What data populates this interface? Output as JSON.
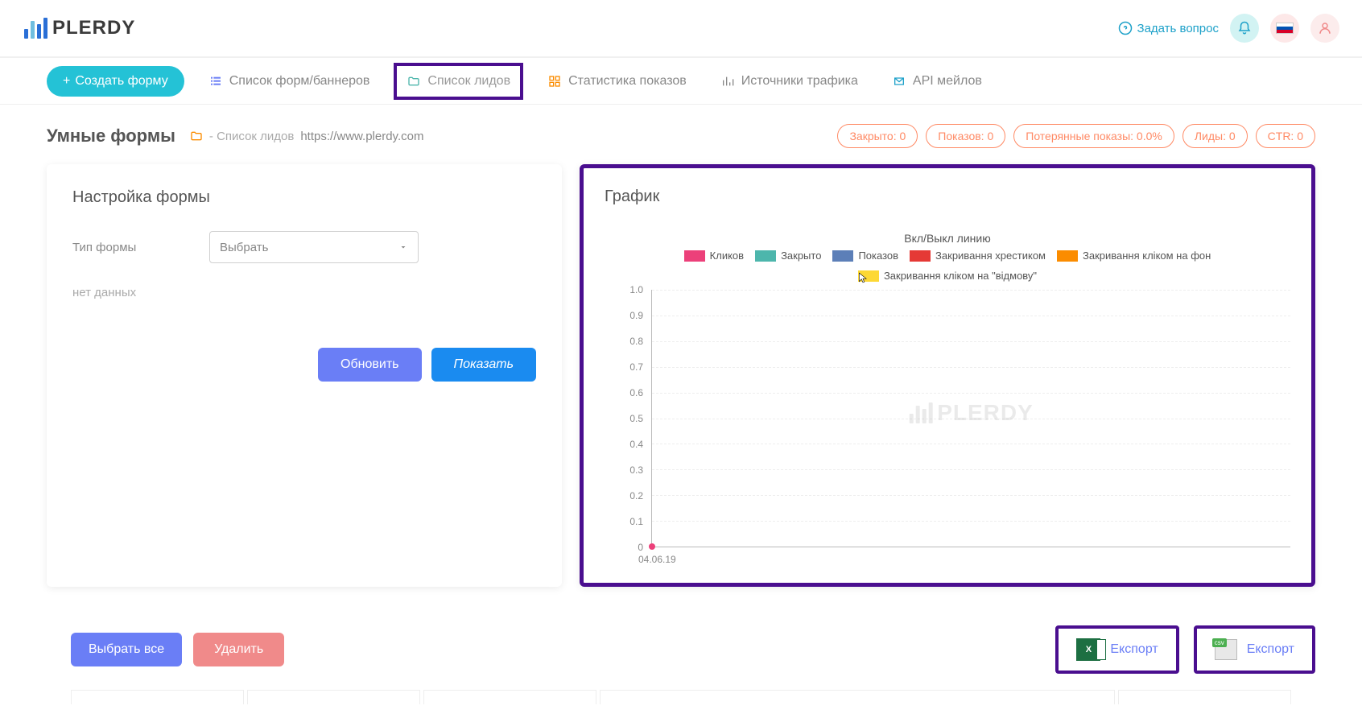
{
  "header": {
    "brand": "PLERDY",
    "ask_question": "Задать вопрос"
  },
  "toolbar": {
    "create_form": "Создать форму"
  },
  "tabs": {
    "forms_list": "Список форм/баннеров",
    "leads_list": "Список лидов",
    "stats": "Статистика показов",
    "traffic_sources": "Источники трафика",
    "api_mail": "API мейлов"
  },
  "page": {
    "title": "Умные формы",
    "breadcrumb_leads": "- Список лидов",
    "url": "https://www.plerdy.com"
  },
  "stats_pills": {
    "closed": "Закрыто: 0",
    "shows": "Показов: 0",
    "lost_shows": "Потерянные показы: 0.0%",
    "leads": "Лиды:   0",
    "ctr": "CTR:  0"
  },
  "settings_panel": {
    "title": "Настройка формы",
    "form_type_label": "Тип формы",
    "select_placeholder": "Выбрать",
    "no_data": "нет данных",
    "update_btn": "Обновить",
    "show_btn": "Показать"
  },
  "chart_panel": {
    "title": "График",
    "toggle_label": "Вкл/Выкл линию",
    "legend": {
      "clicks": "Кликов",
      "closed": "Закрыто",
      "shows": "Показов",
      "close_x": "Закривання хрестиком",
      "close_bg": "Закривання кліком на фон",
      "close_cancel": "Закривання кліком на \"відмову\""
    },
    "watermark": "PLERDY"
  },
  "chart_data": {
    "type": "line",
    "xlabel": "",
    "ylabel": "",
    "ylim": [
      0,
      1.0
    ],
    "y_ticks": [
      "1.0",
      "0.9",
      "0.8",
      "0.7",
      "0.6",
      "0.5",
      "0.4",
      "0.3",
      "0.2",
      "0.1",
      "0"
    ],
    "x": [
      "04.06.19"
    ],
    "series": [
      {
        "name": "Кликов",
        "color": "#ec407a",
        "values": [
          0
        ]
      },
      {
        "name": "Закрыто",
        "color": "#4db6ac",
        "values": [
          0
        ]
      },
      {
        "name": "Показов",
        "color": "#5c7fb8",
        "values": [
          0
        ]
      },
      {
        "name": "Закривання хрестиком",
        "color": "#e53935",
        "values": [
          0
        ]
      },
      {
        "name": "Закривання кліком на фон",
        "color": "#fb8c00",
        "values": [
          0
        ]
      },
      {
        "name": "Закривання кліком на \"відмову\"",
        "color": "#fdd835",
        "values": [
          0
        ]
      }
    ]
  },
  "legend_colors": {
    "clicks": "#ec407a",
    "closed": "#4db6ac",
    "shows": "#5c7fb8",
    "close_x": "#e53935",
    "close_bg": "#fb8c00",
    "close_cancel": "#fdd835"
  },
  "bottom": {
    "select_all": "Выбрать все",
    "delete": "Удалить",
    "export_excel": "Експорт",
    "export_csv": "Експорт"
  }
}
